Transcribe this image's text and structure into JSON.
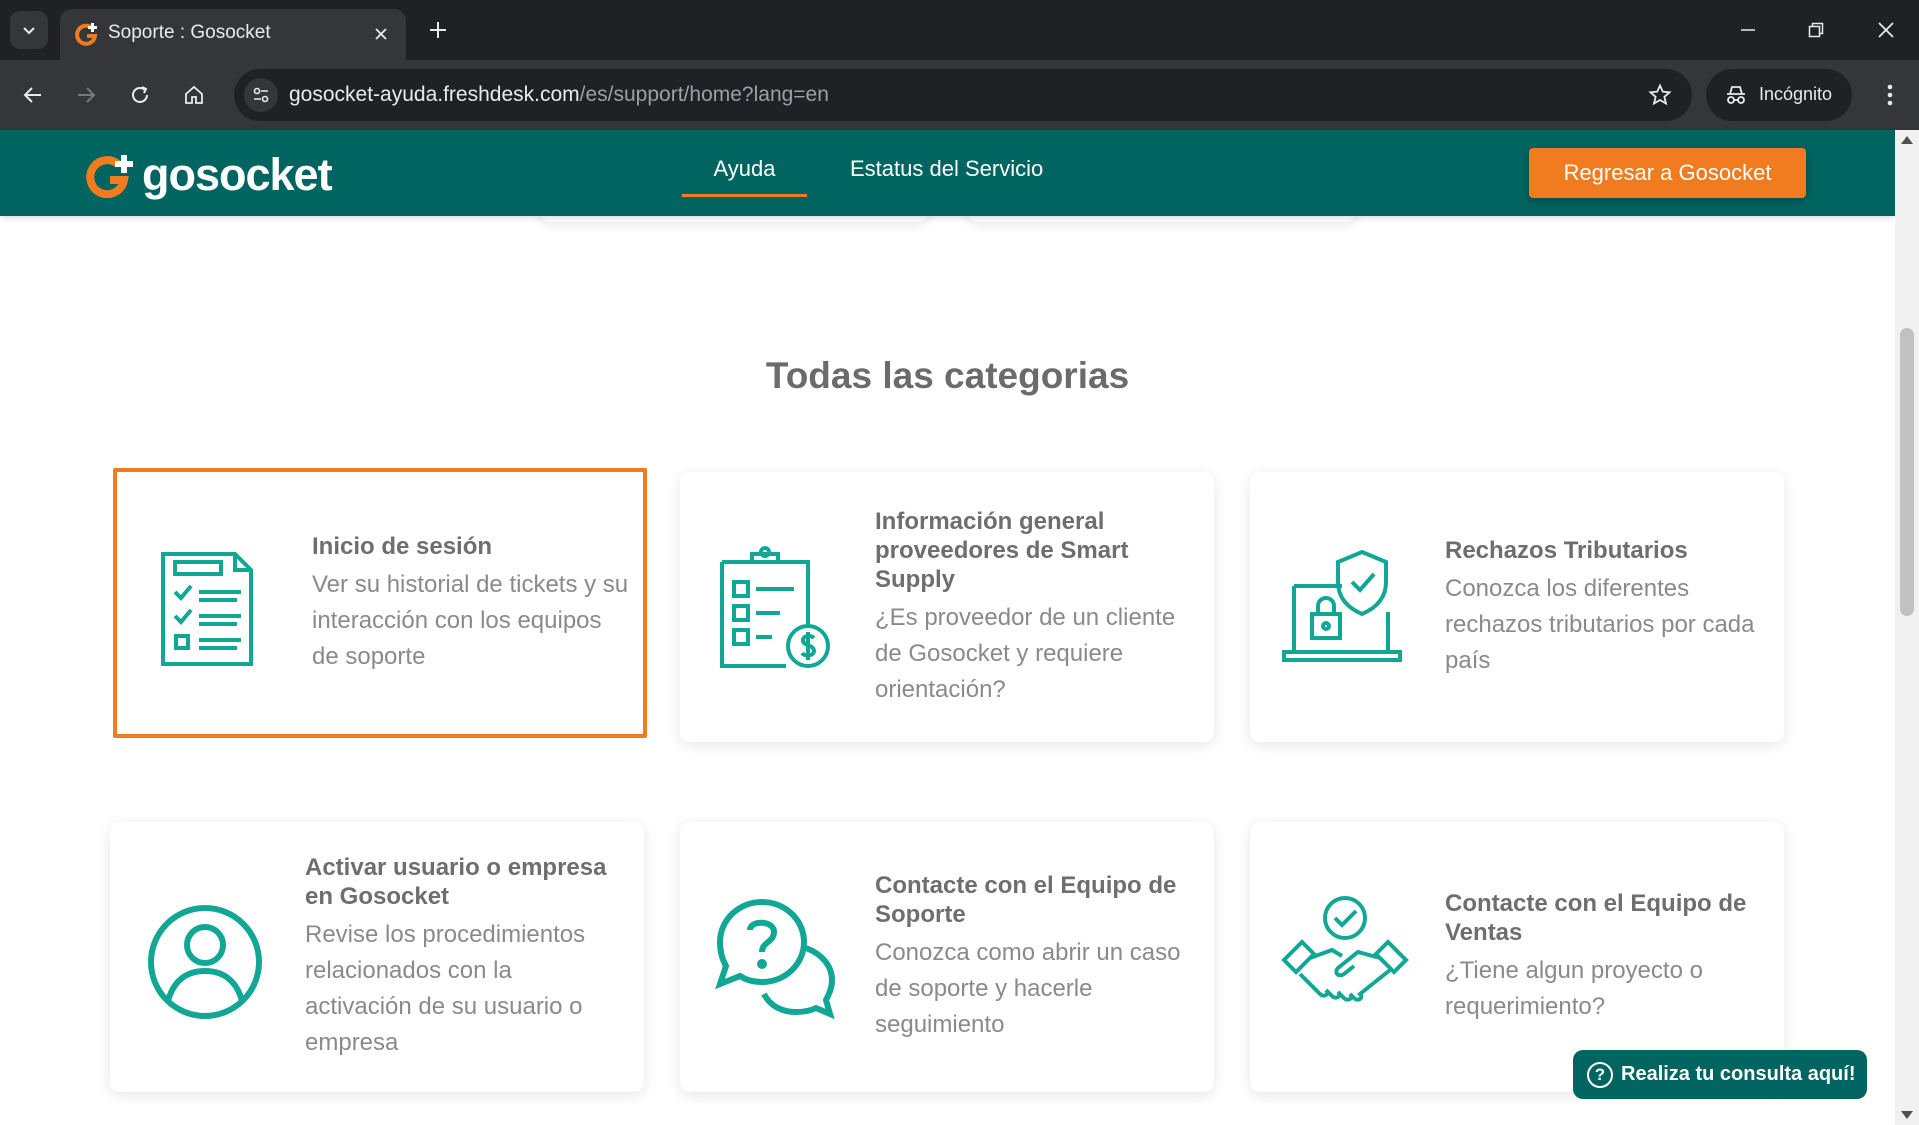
{
  "browser": {
    "tab_title": "Soporte : Gosocket",
    "url_host": "gosocket-ayuda.freshdesk.com",
    "url_path": "/es/support/home?lang=en",
    "incognito_label": "Incógnito"
  },
  "header": {
    "logo_text": "gosocket",
    "nav": {
      "help": "Ayuda",
      "status": "Estatus del Servicio"
    },
    "cta": "Regresar a Gosocket"
  },
  "section": {
    "title": "Todas las categorias"
  },
  "categories": [
    {
      "title": "Inicio de sesión",
      "desc": "Ver su historial de tickets y su interacción con los equipos de soporte",
      "icon": "checklist-icon"
    },
    {
      "title": "Información general proveedores de Smart Supply",
      "desc": "¿Es proveedor de un cliente de Gosocket y requiere orientación?",
      "icon": "clipboard-dollar-icon"
    },
    {
      "title": "Rechazos Tributarios",
      "desc": "Conozca los diferentes rechazos tributarios por cada país",
      "icon": "laptop-shield-icon"
    },
    {
      "title": "Activar usuario o empresa en Gosocket",
      "desc": "Revise los procedimientos relacionados con la activación de su usuario o empresa",
      "icon": "user-circle-icon"
    },
    {
      "title": "Contacte con el Equipo de Soporte",
      "desc": "Conozca como abrir un caso de soporte y hacerle seguimiento",
      "icon": "chat-question-icon"
    },
    {
      "title": "Contacte con el Equipo de Ventas",
      "desc": "¿Tiene algun proyecto o requerimiento?",
      "icon": "handshake-icon"
    }
  ],
  "chat": {
    "label": "Realiza tu consulta aquí!"
  },
  "colors": {
    "brand_teal": "#006460",
    "accent_orange": "#f07c1f",
    "icon_teal": "#12a794"
  }
}
